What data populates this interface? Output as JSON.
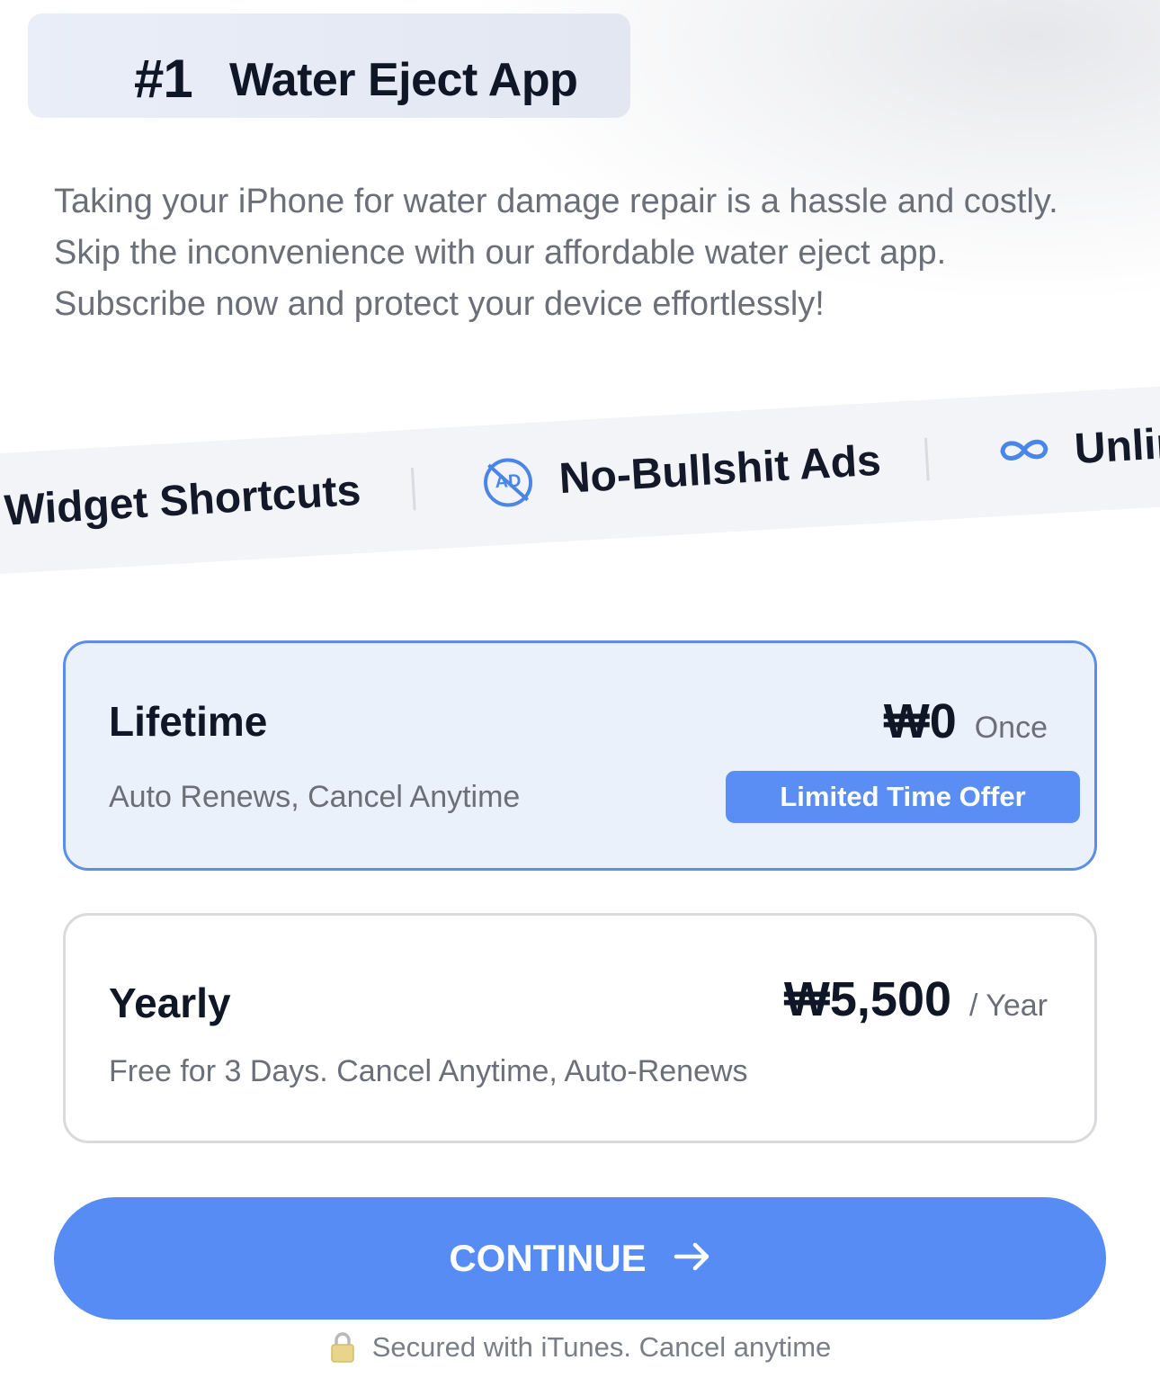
{
  "header": {
    "rank": "#1",
    "title": "Water Eject App"
  },
  "description": {
    "lines": [
      "Taking your iPhone for water damage repair is a hassle and costly.",
      "Skip the inconvenience with our affordable water eject app.",
      "Subscribe now and protect your device effortlessly!"
    ]
  },
  "features": {
    "items": [
      {
        "label": "Widget Shortcuts"
      },
      {
        "label": "No-Bullshit Ads",
        "icon": "no-ads-icon"
      },
      {
        "label": "Unlir",
        "icon": "infinity-icon"
      }
    ],
    "icon_text": "AD"
  },
  "plans": [
    {
      "name": "Lifetime",
      "description": "Auto Renews, Cancel Anytime",
      "price": "₩0",
      "period": "Once",
      "tag": "Limited Time Offer",
      "selected": true
    },
    {
      "name": "Yearly",
      "description": "Free for 3 Days. Cancel Anytime, Auto-Renews",
      "price": "₩5,500",
      "period": "/ Year",
      "selected": false
    }
  ],
  "continue_button": {
    "label": "CONTINUE",
    "icon": "arrow-right-icon"
  },
  "footer": {
    "secure_text": "Secured with iTunes. Cancel anytime",
    "icon": "lock-icon"
  },
  "colors": {
    "accent": "#568cf4",
    "selected_border": "#5b8ee6",
    "selected_bg": "#ebf1fb",
    "text_dark": "#0f1626",
    "text_muted": "#6b6f78"
  }
}
